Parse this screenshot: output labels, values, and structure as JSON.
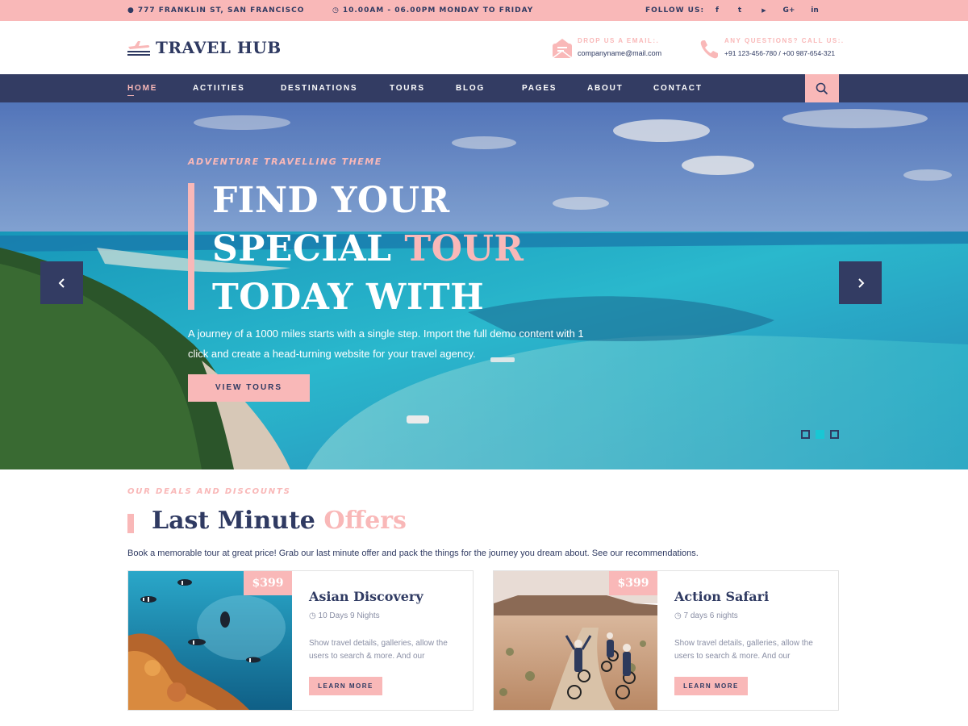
{
  "topbar": {
    "address": "777 FRANKLIN ST, SAN FRANCISCO",
    "hours": "10.00AM - 06.00PM MONDAY TO FRIDAY",
    "follow_label": "FOLLOW US:",
    "social": [
      {
        "icon": "facebook-icon",
        "glyph": "f"
      },
      {
        "icon": "twitter-icon",
        "glyph": "t"
      },
      {
        "icon": "youtube-icon",
        "glyph": "▶"
      },
      {
        "icon": "google-plus-icon",
        "glyph": "G+"
      },
      {
        "icon": "linkedin-icon",
        "glyph": "in"
      }
    ]
  },
  "header": {
    "logo_text": "TRAVEL HUB",
    "email_label": "DROP US A EMAIL:.",
    "email_value": "companyname@mail.com",
    "phone_label": "ANY QUESTIONS? CALL US:.",
    "phone_value": "+91 123-456-780 / +00 987-654-321"
  },
  "nav": {
    "items": [
      "HOME",
      "ACTIITIES",
      "DESTINATIONS",
      "TOURS",
      "BLOG",
      "PAGES",
      "ABOUT",
      "CONTACT"
    ],
    "active_index": 0
  },
  "hero": {
    "kicker": "ADVENTURE TRAVELLING THEME",
    "title_line1": "FIND YOUR",
    "title_line2_a": "SPECIAL ",
    "title_line2_b": "TOUR",
    "title_line3": "TODAY WITH",
    "text": "A journey of a 1000 miles starts with a single step. Import the full demo content with 1 click and create a head-turning website for your travel agency.",
    "button": "VIEW TOURS",
    "slide_count": 3,
    "active_slide": 1
  },
  "deals": {
    "kicker": "OUR DEALS AND DISCOUNTS",
    "title_a": "Last Minute ",
    "title_b": "Offers",
    "text": "Book a memorable tour at great price! Grab our last minute offer and pack the things for the journey you dream about. See our recommendations.",
    "cards": [
      {
        "price": "$399",
        "title": "Asian Discovery",
        "duration": "10 Days 9 Nights",
        "desc": "Show travel details, galleries, allow the users to search & more. And our",
        "button": "LEARN MORE"
      },
      {
        "price": "$399",
        "title": "Action Safari",
        "duration": "7 days 6 nights",
        "desc": "Show travel details, galleries, allow the users to search & more. And our",
        "button": "LEARN MORE"
      }
    ]
  },
  "colors": {
    "accent_pink": "#f9b8b8",
    "navy": "#333c63",
    "turquoise": "#19c7d4"
  }
}
